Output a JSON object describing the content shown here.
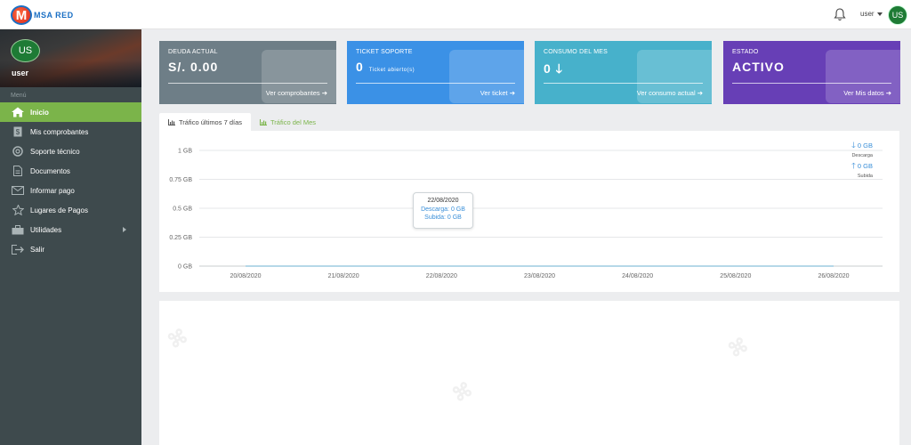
{
  "app": {
    "logo_text": "MSA RED",
    "logo_letter": "M",
    "user_name": "user",
    "avatar_initials": "US"
  },
  "sidebar": {
    "profile_initials": "US",
    "profile_name": "user",
    "menu_header": "Menú",
    "items": [
      {
        "label": "Inicio",
        "icon": "home-icon",
        "active": true
      },
      {
        "label": "Mis comprobantes",
        "icon": "receipt-icon"
      },
      {
        "label": "Soporte técnico",
        "icon": "lifebuoy-icon"
      },
      {
        "label": "Documentos",
        "icon": "document-icon"
      },
      {
        "label": "Informar pago",
        "icon": "envelope-icon"
      },
      {
        "label": "Lugares de Pagos",
        "icon": "star-icon"
      },
      {
        "label": "Utilidades",
        "icon": "toolbox-icon",
        "has_submenu": true
      },
      {
        "label": "Salir",
        "icon": "logout-icon"
      }
    ]
  },
  "cards": [
    {
      "title": "DEUDA ACTUAL",
      "value": "S/. 0.00",
      "sub": "",
      "link": "Ver comprobantes ➔",
      "color": "#6e7e87"
    },
    {
      "title": "TICKET SOPORTE",
      "value": "0",
      "sub": "Ticket abierto(s)",
      "link": "Ver ticket ➔",
      "color": "#3b91e6"
    },
    {
      "title": "CONSUMO DEL MES",
      "value": "0 🡓",
      "sub": "",
      "link": "Ver consumo actual ➔",
      "color": "#47b1cb"
    },
    {
      "title": "ESTADO",
      "value": "ACTIVO",
      "sub": "",
      "link": "Ver Mis datos ➔",
      "color": "#673fb6"
    }
  ],
  "tabs": [
    {
      "label": "Tráfico últimos 7 días",
      "active": true
    },
    {
      "label": "Tráfico del Mes",
      "active": false
    }
  ],
  "legend": {
    "download_value": "0",
    "download_unit": "GB",
    "download_label": "Descarga",
    "upload_value": "0",
    "upload_unit": "GB",
    "upload_label": "Subida"
  },
  "tooltip": {
    "date": "22/08/2020",
    "download": "Descarga: 0 GB",
    "upload": "Subida: 0 GB"
  },
  "chart_data": {
    "type": "line",
    "x": [
      "20/08/2020",
      "21/08/2020",
      "22/08/2020",
      "23/08/2020",
      "24/08/2020",
      "25/08/2020",
      "26/08/2020"
    ],
    "y_ticks": [
      "1 GB",
      "0.75 GB",
      "0.5 GB",
      "0.25 GB",
      "0 GB"
    ],
    "ylim": [
      0,
      1
    ],
    "series": [
      {
        "name": "Descarga",
        "values": [
          0,
          0,
          0,
          0,
          0,
          0,
          0
        ]
      },
      {
        "name": "Subida",
        "values": [
          0,
          0,
          0,
          0,
          0,
          0,
          0
        ]
      }
    ],
    "grid": true
  }
}
